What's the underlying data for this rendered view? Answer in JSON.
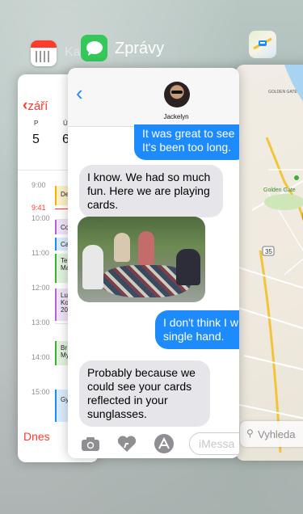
{
  "switcher": {
    "calendar_label": "Ka",
    "messages_label": "Zprávy"
  },
  "calendar": {
    "month_back": "září",
    "weekday_letters": [
      "P",
      "Ú"
    ],
    "day_numbers": [
      "5",
      "6"
    ],
    "hours": [
      "9:00",
      "10:00",
      "11:00",
      "12:00",
      "13:00",
      "14:00",
      "15:00"
    ],
    "current_time": "9:41",
    "events": [
      {
        "text": "De",
        "color": "#f5b400",
        "bg": "#fdf1c9"
      },
      {
        "text": "Co",
        "color": "#b364d6",
        "bg": "#f1e3f8"
      },
      {
        "text": "Ca",
        "color": "#1d8cf2",
        "bg": "#dbecfc"
      },
      {
        "text": "Te\nMa",
        "color": "#3fae35",
        "bg": "#e1f3de"
      },
      {
        "text": "Lu\nKo\n20",
        "color": "#b364d6",
        "bg": "#f1e3f8"
      },
      {
        "text": "Br\nMy",
        "color": "#3fae35",
        "bg": "#e1f3de"
      },
      {
        "text": "Gy",
        "color": "#1d8cf2",
        "bg": "#dbecfc"
      }
    ],
    "today_button": "Dnes"
  },
  "messages": {
    "contact_name": "Jackelyn",
    "conversation": [
      {
        "side": "out",
        "text": "It was great to see\nIt's been too long."
      },
      {
        "side": "in",
        "text": "I know. We had so much fun. Here we are playing cards."
      },
      {
        "side": "out",
        "text": "I don't think I w\nsingle hand."
      },
      {
        "side": "in",
        "text": "Probably because we could see your cards reflected in your sunglasses."
      }
    ],
    "input_placeholder": "iMessa"
  },
  "maps": {
    "labels": [
      "GOLDEN GATE",
      "Golden Gate",
      "35",
      "1"
    ],
    "search_placeholder": "Vyhleda"
  },
  "colors": {
    "ios_blue": "#1e8bfd",
    "ios_red": "#ff3b30",
    "incoming_bubble": "#e5e5ea",
    "messages_green": "#34c759"
  }
}
